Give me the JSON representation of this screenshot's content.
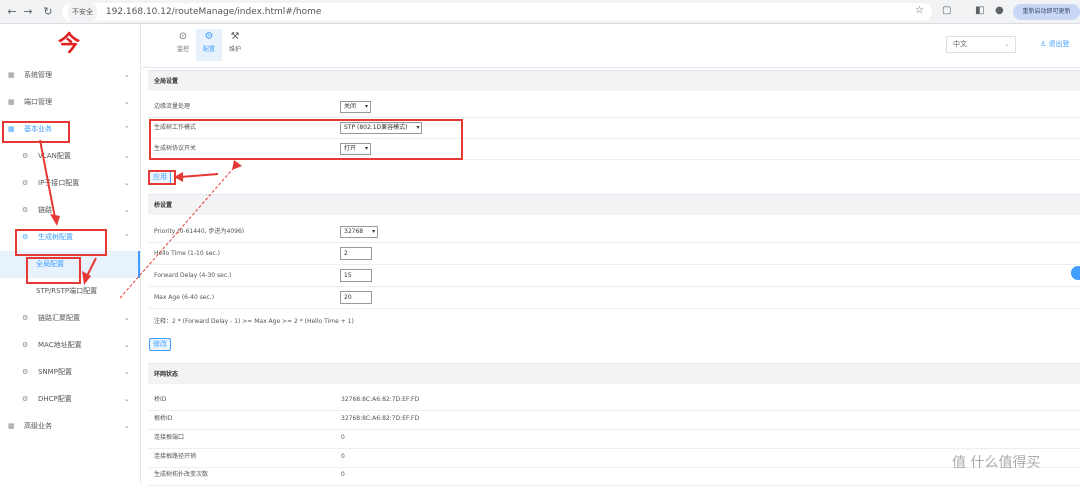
{
  "browser": {
    "security": "不安全",
    "url": "192.168.10.12/routeManage/index.html#/home",
    "relaunch": "重新启动即可更新"
  },
  "logo": "今",
  "topnav": [
    {
      "label": "监控",
      "icon": "⊙"
    },
    {
      "label": "配置",
      "icon": "⚙"
    },
    {
      "label": "维护",
      "icon": "⚒"
    }
  ],
  "lang": "中文",
  "user": "退出登",
  "sidebar": {
    "items": [
      {
        "label": "系统管理",
        "icon": "▦"
      },
      {
        "label": "端口管理",
        "icon": "▦"
      },
      {
        "label": "基本业务",
        "icon": "▦"
      },
      {
        "label": "VLAN配置",
        "icon": "⚙"
      },
      {
        "label": "IP子接口配置",
        "icon": "⚙"
      },
      {
        "label": "链路",
        "icon": "⚙"
      },
      {
        "label": "生成树配置",
        "icon": "⚙"
      },
      {
        "label": "全局配置"
      },
      {
        "label": "STP/RSTP端口配置"
      },
      {
        "label": "链路汇聚配置",
        "icon": "⚙"
      },
      {
        "label": "MAC地址配置",
        "icon": "⚙"
      },
      {
        "label": "SNMP配置",
        "icon": "⚙"
      },
      {
        "label": "DHCP配置",
        "icon": "⚙"
      },
      {
        "label": "高级业务",
        "icon": "▦"
      }
    ]
  },
  "global": {
    "header": "全局设置",
    "rows": [
      {
        "label": "边缘流量处理",
        "value": "关闭"
      },
      {
        "label": "生成树工作模式",
        "value": "STP (802.1D兼容模式)"
      },
      {
        "label": "生成树协议开关",
        "value": "打开"
      }
    ],
    "apply": "应用"
  },
  "bridge": {
    "header": "桥设置",
    "rows": [
      {
        "label": "Priority (0-61440, 步进为4096)",
        "value": "32768"
      },
      {
        "label": "Hello Time (1-10 sec.)",
        "value": "2"
      },
      {
        "label": "Forward Delay (4-30 sec.)",
        "value": "15"
      },
      {
        "label": "Max Age (6-40 sec.)",
        "value": "20"
      }
    ],
    "note": "注释：2 * (Forward Delay - 1) >= Max Age >= 2 * (Hello Time + 1)",
    "modify": "修改"
  },
  "info": {
    "header": "环网状态",
    "rows": [
      {
        "label": "桥ID",
        "value": "32768:8C:A6:82:7D:EF:FD"
      },
      {
        "label": "根桥ID",
        "value": "32768:8C:A6:82:7D:EF:FD"
      },
      {
        "label": "连接根端口",
        "value": "0"
      },
      {
        "label": "连接根路径开销",
        "value": "0"
      },
      {
        "label": "生成树拓扑改变次数",
        "value": "0"
      }
    ]
  },
  "watermark": "值 什么值得买"
}
